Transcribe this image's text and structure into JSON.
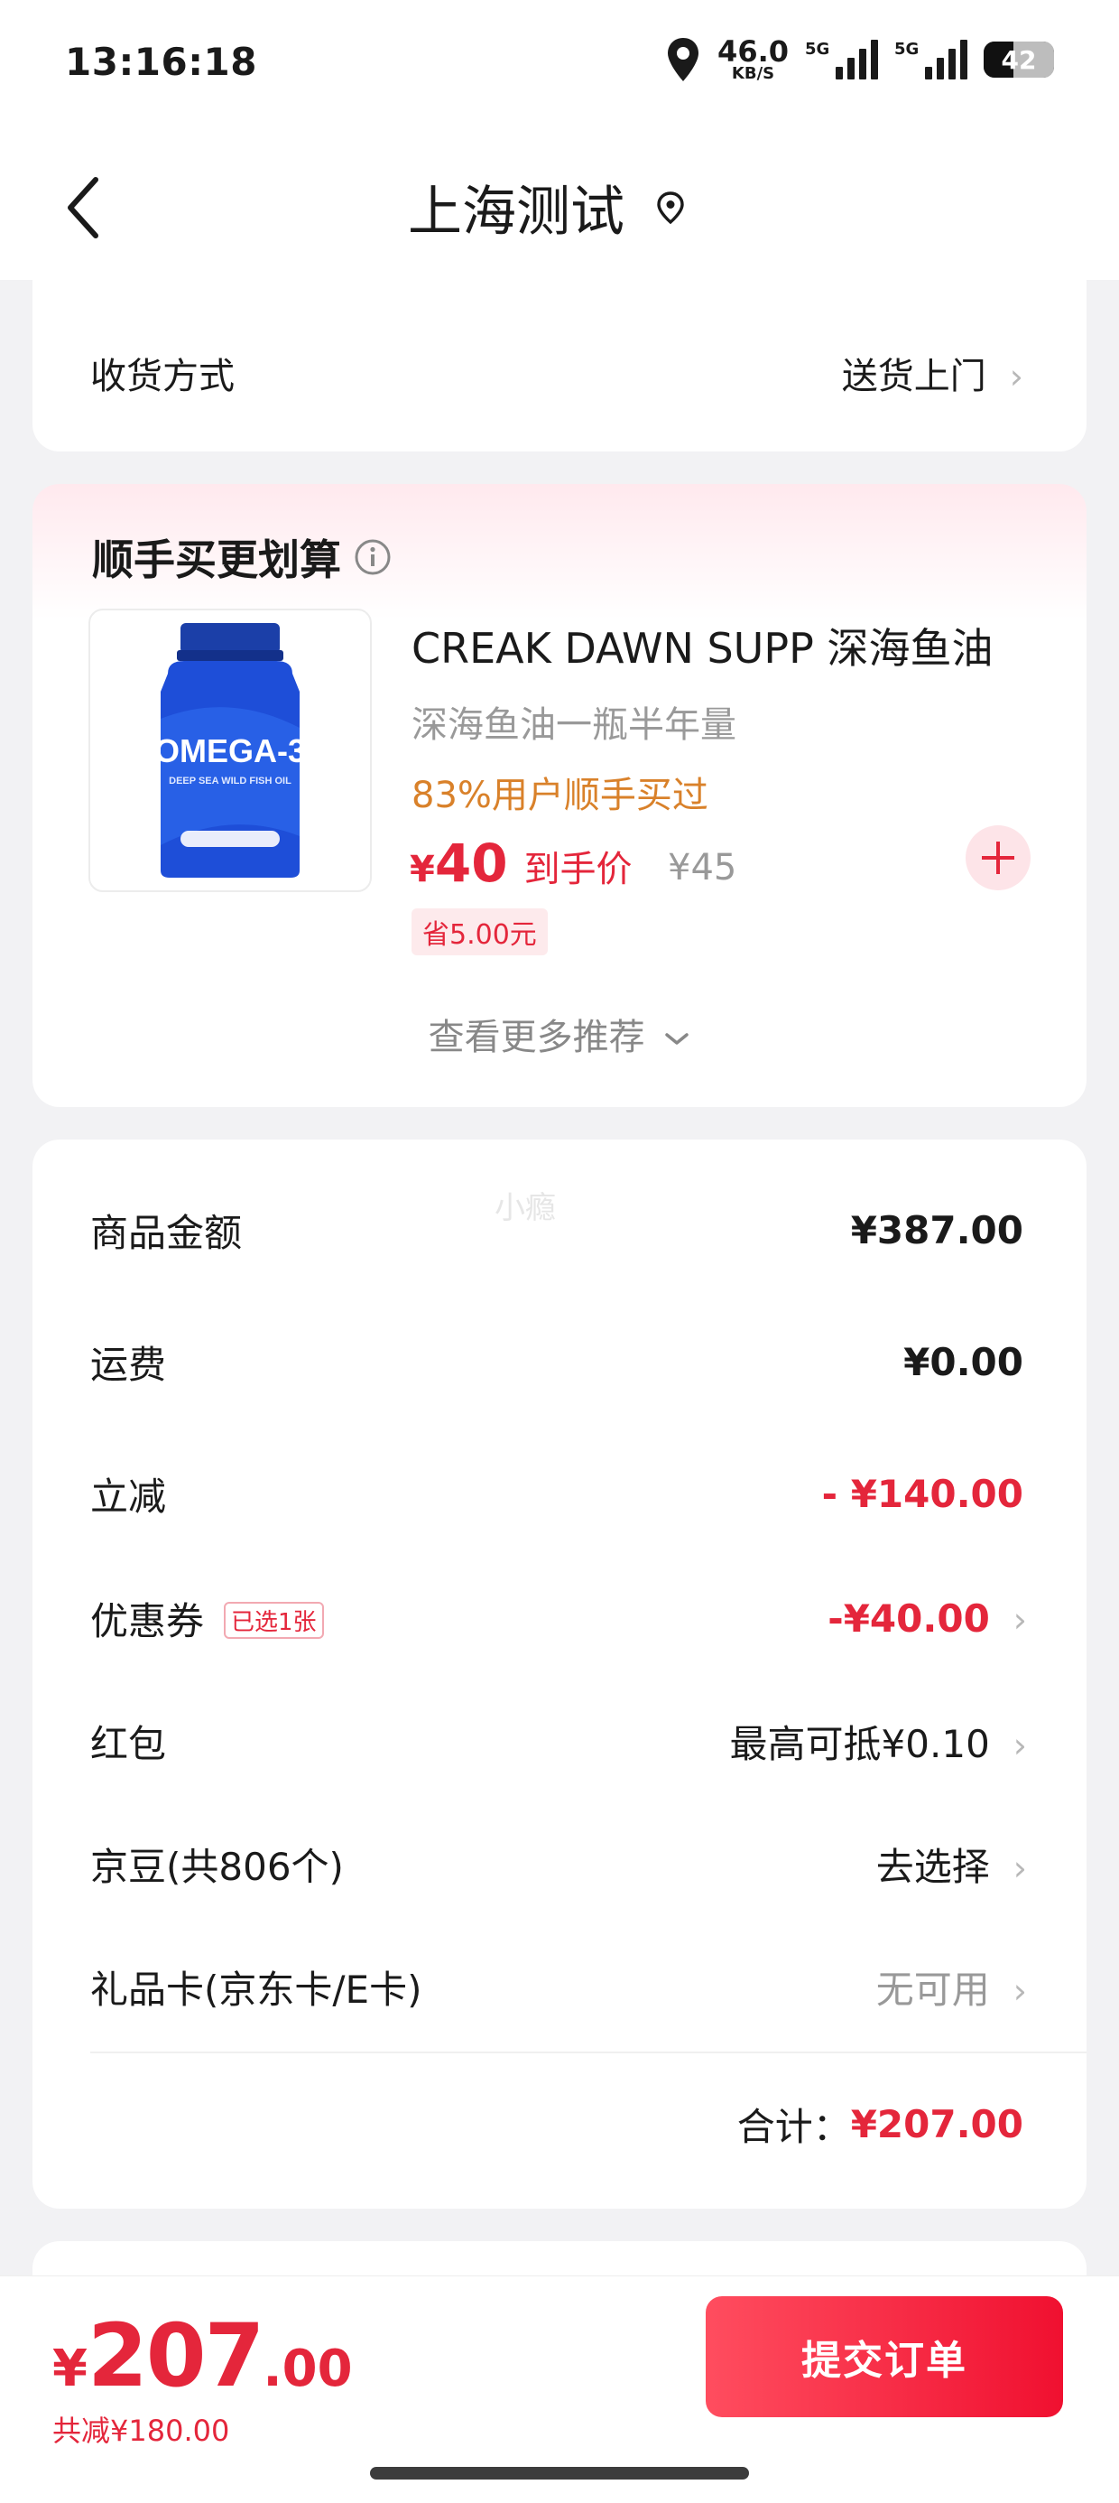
{
  "status_bar": {
    "time": "13:16:18",
    "net_speed_value": "46.0",
    "net_speed_unit": "KB/S",
    "sim1_label": "5G",
    "sim2_label": "5G",
    "battery_level": "42",
    "icons": [
      "location-icon",
      "signal-icon",
      "battery-icon"
    ]
  },
  "nav": {
    "title": "上海测试",
    "icons": [
      "back-icon",
      "location-icon"
    ]
  },
  "delivery": {
    "label": "收货方式",
    "value": "送货上门"
  },
  "recommend": {
    "title": "顺手买更划算",
    "product": {
      "image_text": "OMEGA-3",
      "image_caption": "DEEP SEA WILD FISH OIL",
      "name": "CREAK DAWN SUPP 深海鱼油",
      "subtitle": "深海鱼油一瓶半年量",
      "note": "83%用户顺手买过",
      "currency": "¥",
      "price": "40",
      "price_label": "到手价",
      "original_price": "¥45",
      "save_badge": "省5.00元"
    },
    "more_label": "查看更多推荐"
  },
  "watermark": "小瘾",
  "fees": {
    "items_label": "商品金额",
    "items_value": "¥387.00",
    "shipping_label": "运费",
    "shipping_value": "¥0.00",
    "discount_label": "立减",
    "discount_value": "- ¥140.00",
    "coupon_label": "优惠券",
    "coupon_tag": "已选1张",
    "coupon_value": "-¥40.00",
    "redpacket_label": "红包",
    "redpacket_value": "最高可抵¥0.10",
    "beans_label": "京豆(共806个)",
    "beans_value": "去选择",
    "giftcard_label": "礼品卡(京东卡/E卡)",
    "giftcard_value": "无可用",
    "total_label": "合计：",
    "total_value": "¥207.00"
  },
  "bottom": {
    "currency": "¥",
    "total_int": "207",
    "total_dec": ".00",
    "saved": "共减¥180.00",
    "submit_label": "提交订单"
  },
  "colors": {
    "accent_red": "#e4263b",
    "orange_note": "#d9812a",
    "background": "#f2f2f4"
  }
}
